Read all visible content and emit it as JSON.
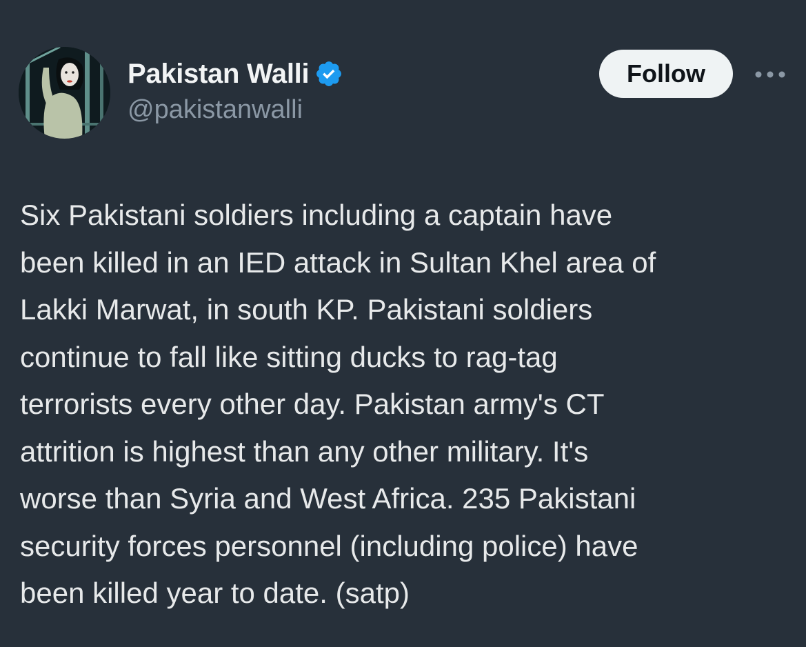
{
  "author": {
    "display_name": "Pakistan Walli",
    "handle": "@pakistanwalli",
    "verified_icon": "verified-badge-icon",
    "avatar_icon": "avatar-illustration"
  },
  "actions": {
    "follow_label": "Follow",
    "more_icon": "more-horizontal-icon"
  },
  "tweet": {
    "text": "Six Pakistani soldiers including a captain have\nbeen killed in an IED attack in Sultan Khel area of\nLakki Marwat, in south KP. Pakistani soldiers\ncontinue to fall like sitting ducks to rag-tag\nterrorists every other day. Pakistan army's CT\nattrition is highest than any other military. It's\nworse than Syria and West Africa. 235 Pakistani\nsecurity forces personnel (including police) have\nbeen killed year to date. (satp)"
  },
  "colors": {
    "background": "#27303a",
    "text": "#e7e9ea",
    "secondary_text": "#8b98a5",
    "verified": "#1d9bf0",
    "follow_bg": "#eff3f4"
  }
}
